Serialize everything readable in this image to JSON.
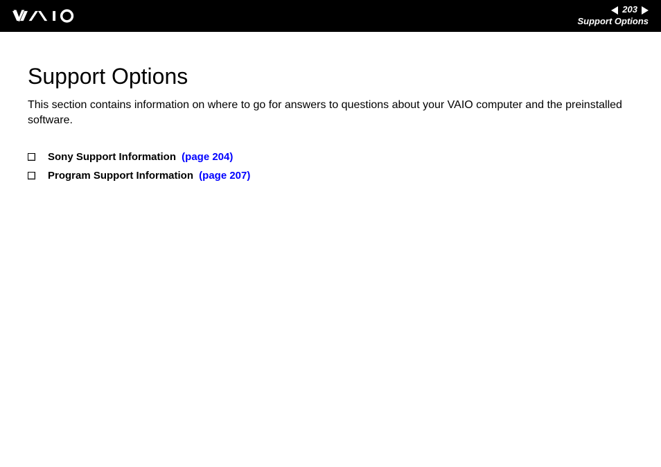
{
  "header": {
    "page_number": "203",
    "section_label": "Support Options"
  },
  "main": {
    "title": "Support Options",
    "intro": "This section contains information on where to go for answers to questions about your VAIO computer and the preinstalled software.",
    "list": [
      {
        "label": "Sony Support Information",
        "link": "(page 204)"
      },
      {
        "label": "Program Support Information",
        "link": "(page 207)"
      }
    ]
  }
}
